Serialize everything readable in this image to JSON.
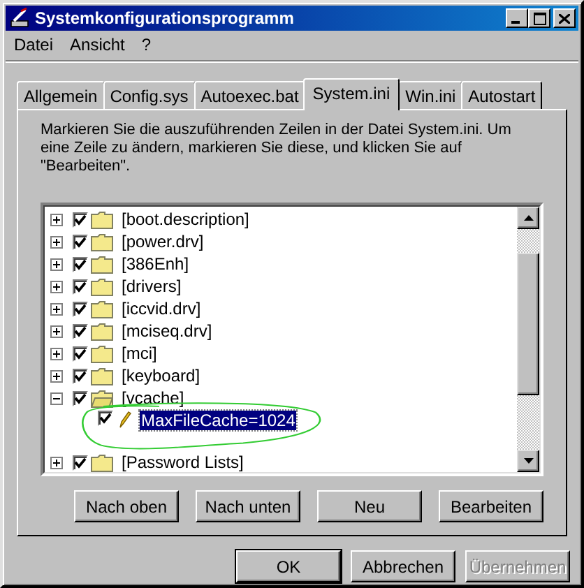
{
  "window": {
    "title": "Systemkonfigurationsprogramm"
  },
  "menu": [
    "Datei",
    "Ansicht",
    "?"
  ],
  "tabs": [
    {
      "label": "Allgemein",
      "selected": false
    },
    {
      "label": "Config.sys",
      "selected": false
    },
    {
      "label": "Autoexec.bat",
      "selected": false
    },
    {
      "label": "System.ini",
      "selected": true
    },
    {
      "label": "Win.ini",
      "selected": false
    },
    {
      "label": "Autostart",
      "selected": false
    }
  ],
  "description": "Markieren Sie die auszuführenden Zeilen in der Datei System.ini. Um eine Zeile zu ändern, markieren Sie diese, und klicken Sie auf \"Bearbeiten\".",
  "tree": [
    {
      "kind": "section",
      "label": "[boot.description]",
      "checked": true,
      "expanded": false,
      "selected": false
    },
    {
      "kind": "section",
      "label": "[power.drv]",
      "checked": true,
      "expanded": false,
      "selected": false
    },
    {
      "kind": "section",
      "label": "[386Enh]",
      "checked": true,
      "expanded": false,
      "selected": false
    },
    {
      "kind": "section",
      "label": "[drivers]",
      "checked": true,
      "expanded": false,
      "selected": false
    },
    {
      "kind": "section",
      "label": "[iccvid.drv]",
      "checked": true,
      "expanded": false,
      "selected": false
    },
    {
      "kind": "section",
      "label": "[mciseq.drv]",
      "checked": true,
      "expanded": false,
      "selected": false
    },
    {
      "kind": "section",
      "label": "[mci]",
      "checked": true,
      "expanded": false,
      "selected": false
    },
    {
      "kind": "section",
      "label": "[keyboard]",
      "checked": true,
      "expanded": false,
      "selected": false
    },
    {
      "kind": "section",
      "label": "[vcache]",
      "checked": true,
      "expanded": true,
      "selected": false,
      "children": [
        {
          "kind": "entry",
          "label": "MaxFileCache=1024",
          "checked": true,
          "selected": true
        }
      ]
    },
    {
      "kind": "section",
      "label": "[Password Lists]",
      "checked": true,
      "expanded": false,
      "selected": false
    }
  ],
  "annotation": {
    "kind": "ellipse"
  },
  "panel_buttons": [
    {
      "label": "Nach oben",
      "disabled": false
    },
    {
      "label": "Nach unten",
      "disabled": false
    },
    {
      "label": "Neu",
      "disabled": false
    },
    {
      "label": "Bearbeiten",
      "disabled": false
    }
  ],
  "dialog_buttons": [
    {
      "label": "OK",
      "disabled": false,
      "default": true
    },
    {
      "label": "Abbrechen",
      "disabled": false,
      "default": false
    },
    {
      "label": "Übernehmen",
      "disabled": true,
      "default": false
    }
  ]
}
